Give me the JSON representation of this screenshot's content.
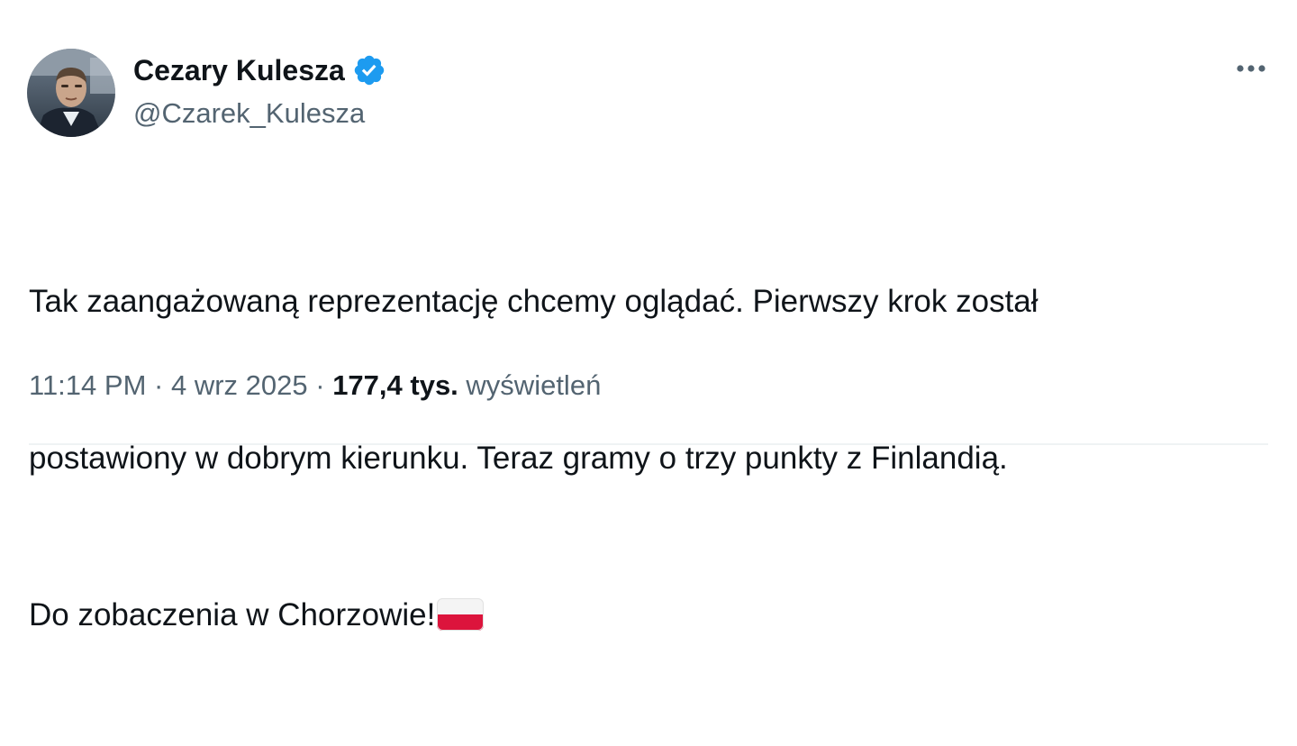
{
  "author": {
    "display_name": "Cezary Kulesza",
    "handle": "@Czarek_Kulesza",
    "verified": true,
    "verified_color": "#1d9bf0"
  },
  "icons": {
    "more": "more-horizontal-icon",
    "verified": "verified-badge-icon",
    "flag": "poland-flag-emoji"
  },
  "tweet": {
    "lines": [
      "Tak zaangażowaną reprezentację chcemy oglądać. Pierwszy krok został",
      "postawiony w dobrym kierunku. Teraz gramy o trzy punkty z Finlandią.",
      "Do zobaczenia w Chorzowie!"
    ],
    "emoji": "🇵🇱"
  },
  "meta": {
    "time": "11:14 PM",
    "separator": "·",
    "date": "4 wrz 2025",
    "views_count": "177,4 tys.",
    "views_label": "wyświetleń"
  }
}
